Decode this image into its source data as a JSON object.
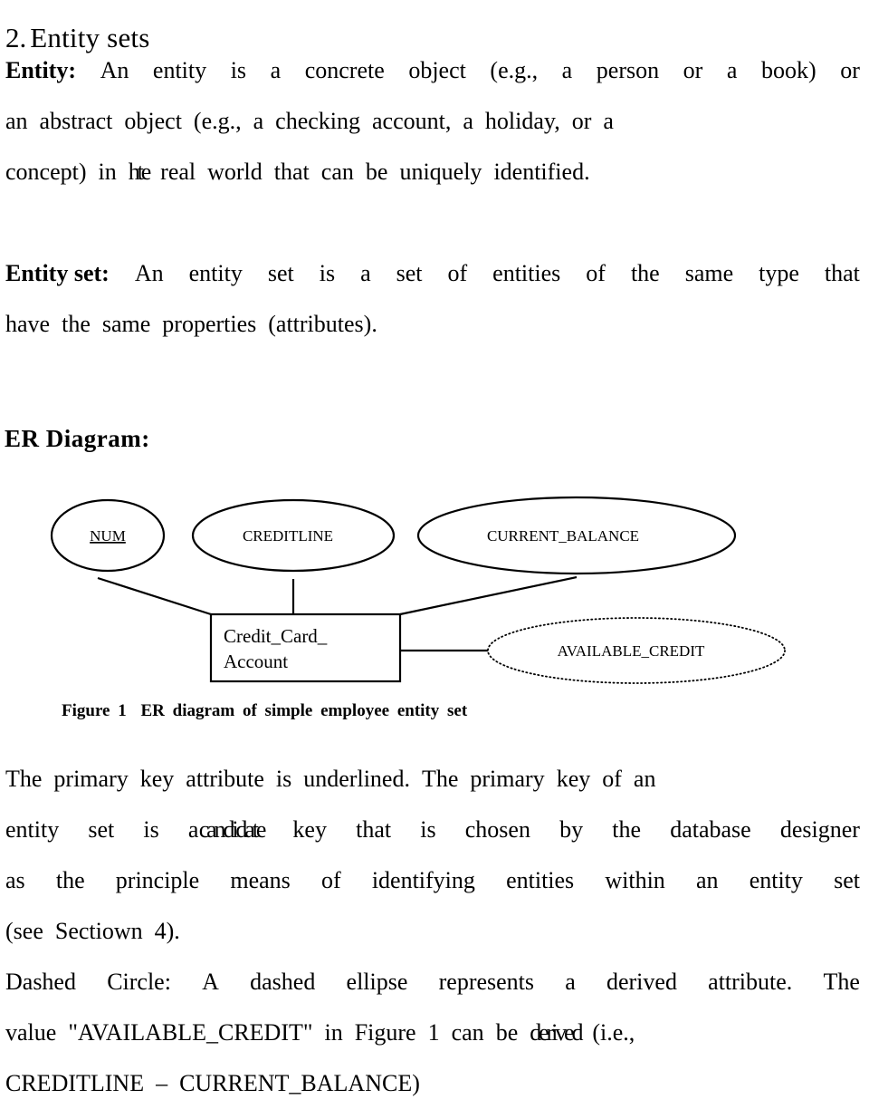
{
  "document": {
    "title_number": "2.",
    "title_text": "Entity sets"
  },
  "sections": {
    "er_diagram_heading": "ER Diagram:"
  },
  "paragraphs": {
    "entity": {
      "label": "Entity:",
      "lines": [
        [
          "An",
          "entity",
          "is",
          "a",
          "concrete",
          "object",
          "(e.g.,",
          "a",
          "person",
          "or",
          "a",
          "book)",
          "or"
        ],
        [
          "an",
          "abstract",
          "object",
          "(e.g.,",
          "a",
          "checking",
          "account,",
          "a",
          "holiday,",
          "or",
          "a"
        ],
        [
          "concept)",
          "in",
          "hte",
          "real",
          "world",
          "that",
          "can",
          "be",
          "uniquely",
          "identified."
        ]
      ],
      "full_text": "Entity: An entity is a concrete object (e.g., a person or a book) or an abstract object (e.g., a checking account, a holiday, or a concept) in hte real world that can be uniquely identified."
    },
    "entity_set": {
      "label": "Entity set:",
      "lines": [
        [
          "An",
          "entity",
          "set",
          "is",
          "a",
          "set",
          "of",
          "entities",
          "of",
          "the",
          "same",
          "type",
          "that"
        ],
        [
          "have",
          "the",
          "same",
          "properties",
          "(attributes)."
        ]
      ],
      "full_text": "Entity set: An entity set is a set of entities of the same type that have the same properties (attributes)."
    },
    "primary_key": {
      "lines": [
        [
          "The",
          "primary",
          "key",
          "attribute",
          "is",
          "underlined.",
          "The",
          "primary",
          "key",
          "of",
          "an"
        ],
        [
          "entity",
          "set",
          "is",
          "a candidate",
          "key",
          "that",
          "is",
          "chosen",
          "by",
          "the",
          "database",
          "designer"
        ],
        [
          "as",
          "the",
          "principle",
          "means",
          "of",
          "identifying",
          "entities",
          "within",
          "an",
          "entity",
          "set"
        ],
        [
          "(see",
          "Sectiown",
          "4)."
        ]
      ],
      "full_text": "The primary key attribute is underlined. The primary key of an entity set is a candidate key that is chosen by the database designer as the principle means of identifying entities within an entity set (see Sectiown 4)."
    },
    "dashed_circle": {
      "lines": [
        [
          "Dashed",
          "Circle:",
          "A",
          "dashed",
          "ellipse",
          "represents",
          "a",
          "derived",
          "attribute.",
          "The"
        ],
        [
          "value",
          "\"AVAILABLE_CREDIT\"",
          "in",
          "Figure",
          "1",
          "can",
          "be",
          "derived",
          "(i.e.,"
        ],
        [
          "CREDITLINE",
          "–",
          "CURRENT_BALANCE)"
        ]
      ],
      "full_text": "Dashed Circle: A dashed ellipse represents a derived attribute. The value \"AVAILABLE_CREDIT\" in Figure 1 can be derived (i.e., CREDITLINE – CURRENT_BALANCE)"
    }
  },
  "figure": {
    "caption": "Figure 1  ER  diagram  of  simple  employee  entity  set",
    "caption_label": "Figure 1",
    "caption_rest": "ER  diagram  of  simple  employee  entity  set",
    "diagram": {
      "entity": {
        "name_line1": "Credit_Card_",
        "name_line2": "Account"
      },
      "attributes": [
        {
          "label": "NUM",
          "kind": "key",
          "underlined": true
        },
        {
          "label": "CREDITLINE",
          "kind": "simple",
          "underlined": false
        },
        {
          "label": "CURRENT_BALANCE",
          "kind": "simple",
          "underlined": false
        },
        {
          "label": "AVAILABLE_CREDIT",
          "kind": "derived",
          "underlined": false
        }
      ]
    }
  },
  "colors": {
    "ink": "#000000",
    "paper": "#ffffff"
  }
}
